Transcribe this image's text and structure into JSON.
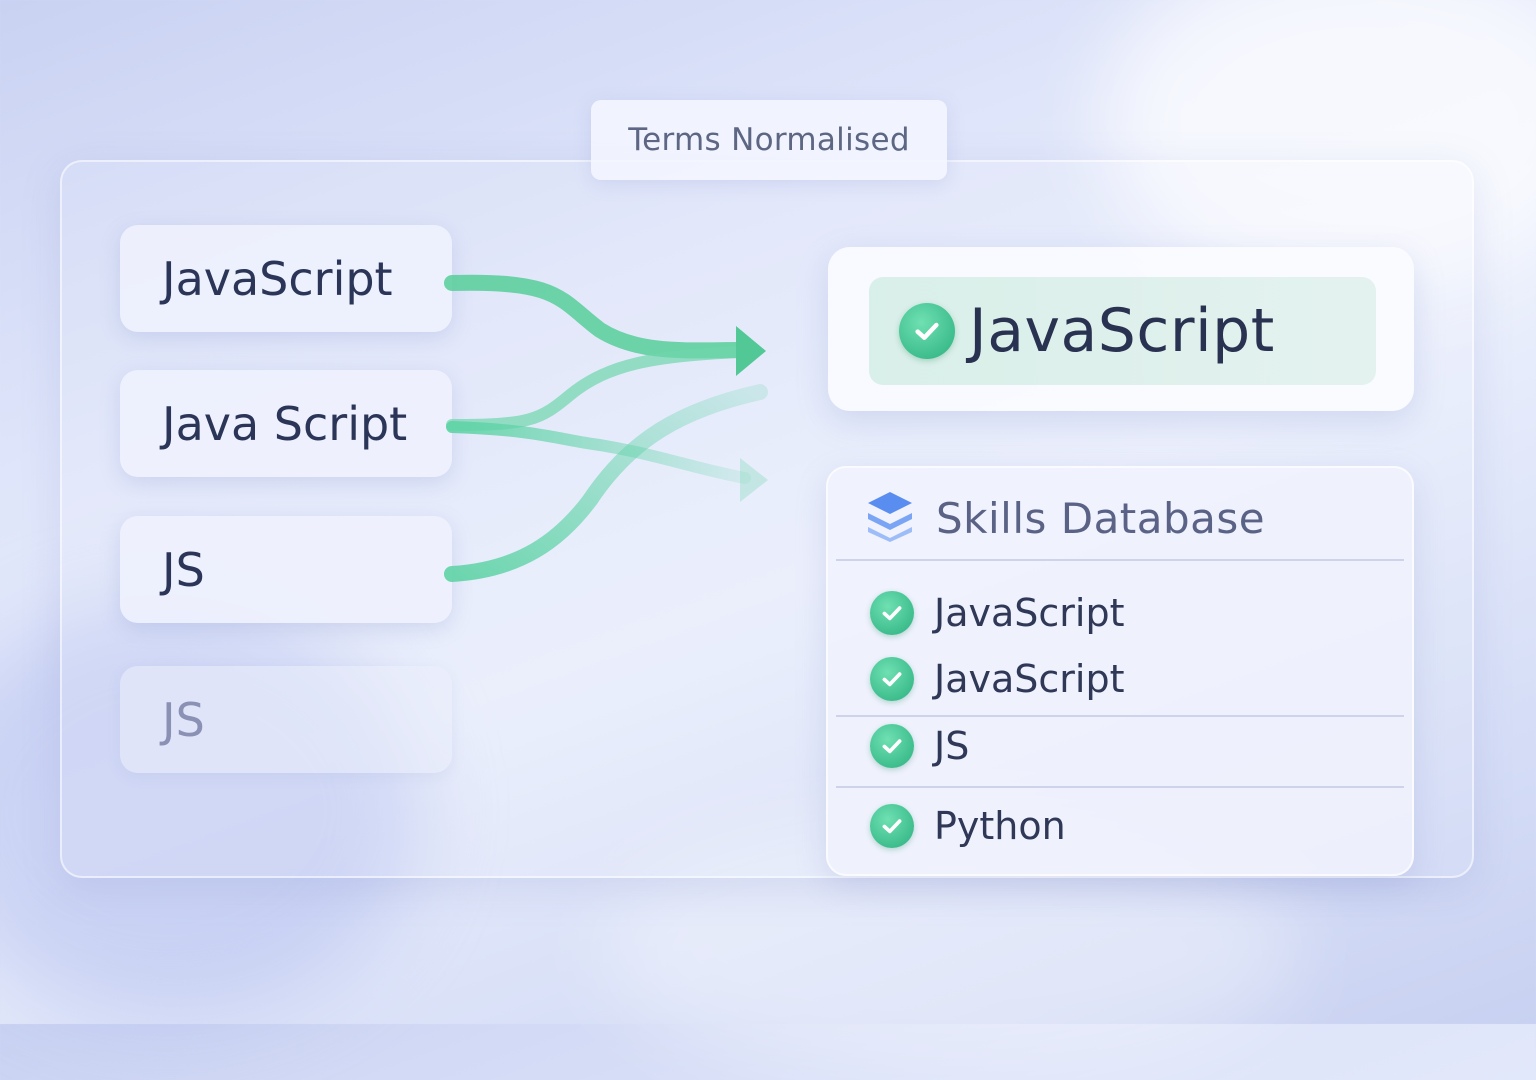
{
  "header": {
    "label": "Terms Normalised"
  },
  "input_terms": [
    {
      "label": "JavaScript"
    },
    {
      "label": "Java Script"
    },
    {
      "label": "JS"
    },
    {
      "label": "JS"
    }
  ],
  "result": {
    "label": "JavaScript"
  },
  "database": {
    "title": "Skills Database",
    "items": [
      {
        "label": "JavaScript"
      },
      {
        "label": "JavaScript"
      },
      {
        "label": "JS"
      },
      {
        "label": "Python"
      }
    ]
  },
  "colors": {
    "accent_green": "#3fbe8e",
    "text_dark": "#2b3557",
    "db_icon_blue": "#5b8ef0"
  },
  "icons": {
    "check": "check-circle-icon",
    "database": "layers-stack-icon",
    "arrow": "arrow-right-icon"
  }
}
